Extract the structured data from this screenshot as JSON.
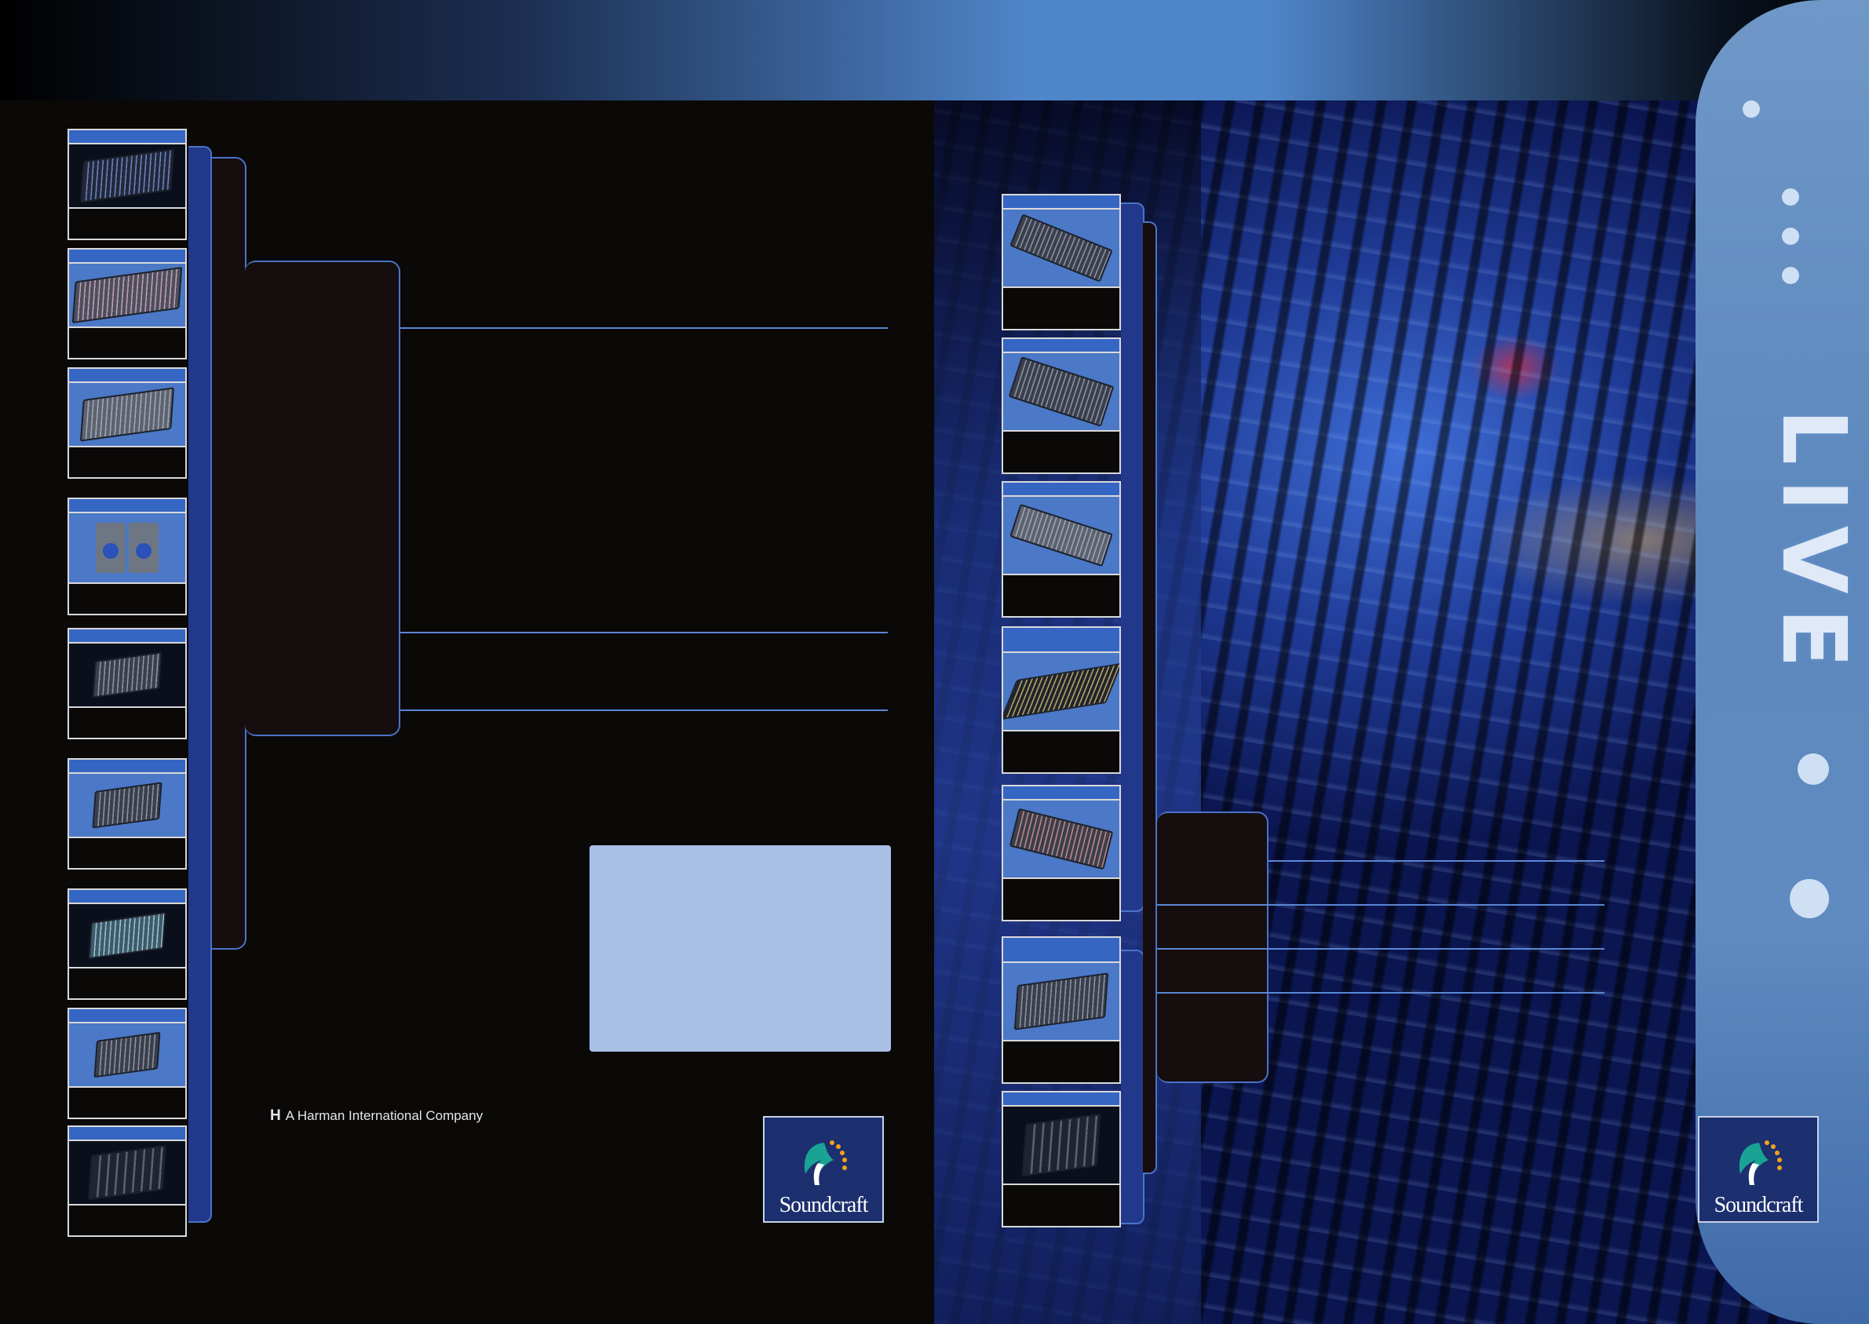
{
  "left_page": {
    "harman_mark": "H",
    "harman_text": "A Harman International Company"
  },
  "brand": {
    "logo_text": "Soundcraft"
  },
  "right_page": {
    "side_title": "LIVE"
  },
  "colors": {
    "accent_blue": "#3666c4",
    "line_blue": "#5b86d4",
    "info_box": "#a9c0e6",
    "logo_teal": "#1aa394",
    "logo_orange": "#f2a21b"
  }
}
